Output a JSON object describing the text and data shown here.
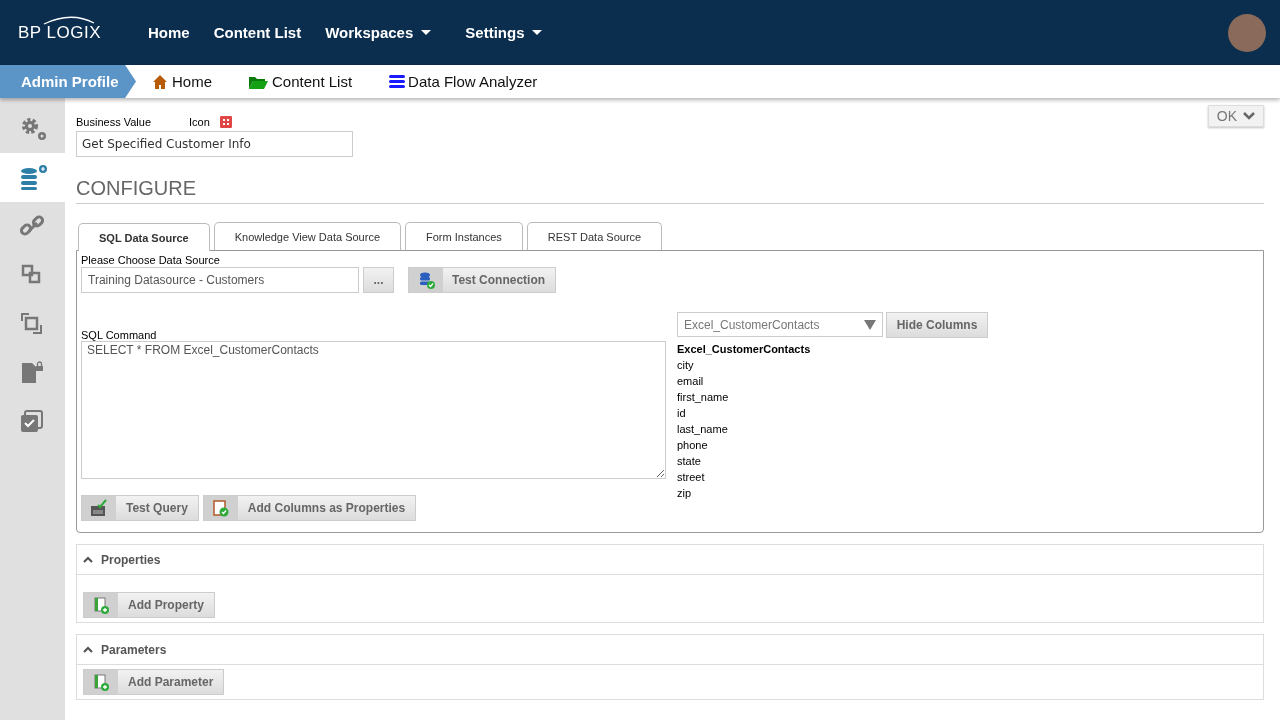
{
  "top_nav": {
    "logo": "BP LOGIX",
    "items": [
      {
        "label": "Home",
        "dropdown": false
      },
      {
        "label": "Content List",
        "dropdown": false
      },
      {
        "label": "Workspaces",
        "dropdown": true
      },
      {
        "label": "Settings",
        "dropdown": true
      }
    ]
  },
  "breadcrumb": {
    "current": "Admin Profile",
    "links": [
      {
        "label": "Home",
        "kind": "home"
      },
      {
        "label": "Content List",
        "kind": "folder"
      },
      {
        "label": "Data Flow Analyzer",
        "kind": "stack"
      }
    ]
  },
  "sidebar": {
    "items": [
      {
        "kind": "gears",
        "selected": false
      },
      {
        "kind": "database",
        "selected": true
      },
      {
        "kind": "link",
        "selected": false
      },
      {
        "kind": "squares",
        "selected": false
      },
      {
        "kind": "squares2",
        "selected": false
      },
      {
        "kind": "lockfile",
        "selected": false
      },
      {
        "kind": "check",
        "selected": false
      }
    ]
  },
  "ok_button": "OK",
  "business_value": {
    "label": "Business Value",
    "icon_label": "Icon",
    "value": "Get Specified Customer Info"
  },
  "heading": "CONFIGURE",
  "tabs": [
    {
      "label": "SQL Data Source",
      "selected": true
    },
    {
      "label": "Knowledge View Data Source",
      "selected": false
    },
    {
      "label": "Form Instances",
      "selected": false
    },
    {
      "label": "REST Data Source",
      "selected": false
    }
  ],
  "data_source": {
    "label": "Please Choose Data Source",
    "value": "Training Datasource - Customers",
    "browse": "...",
    "test_button": "Test Connection"
  },
  "sql": {
    "label": "SQL Command",
    "value": "SELECT * FROM Excel_CustomerContacts"
  },
  "table_select": {
    "value": "Excel_CustomerContacts",
    "button": "Hide Columns"
  },
  "columns": {
    "table": "Excel_CustomerContacts",
    "items": [
      "city",
      "email",
      "first_name",
      "id",
      "last_name",
      "phone",
      "state",
      "street",
      "zip"
    ]
  },
  "query_buttons": [
    {
      "label": "Test Query",
      "kind": "query"
    },
    {
      "label": "Add Columns as Properties",
      "kind": "columns"
    }
  ],
  "sections": [
    {
      "title": "Properties",
      "expanded": true,
      "button": "Add Property"
    },
    {
      "title": "Parameters",
      "expanded": true,
      "button": "Add Parameter"
    }
  ]
}
